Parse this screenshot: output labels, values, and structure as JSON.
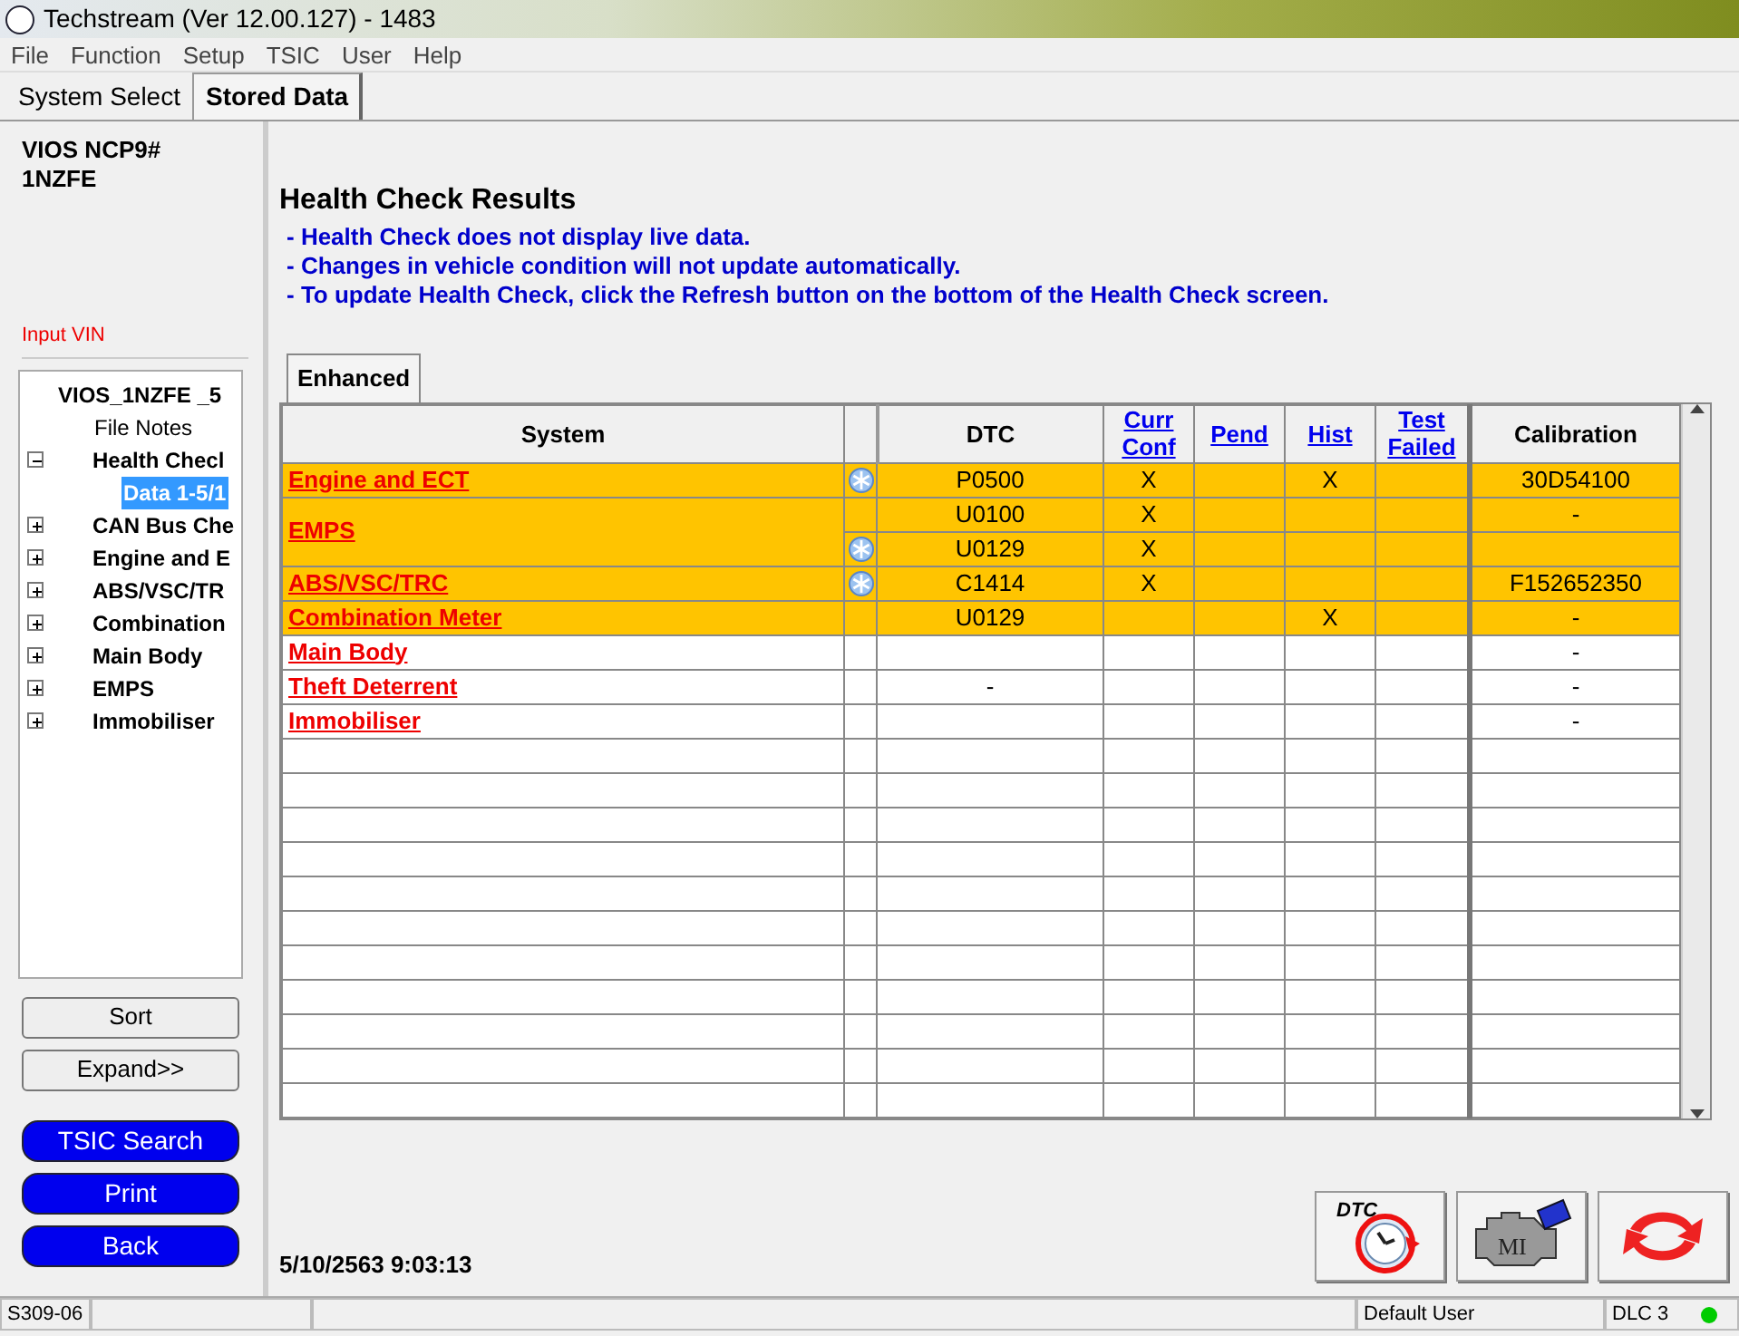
{
  "window": {
    "title": "Techstream (Ver 12.00.127) - 1483"
  },
  "menu": [
    "File",
    "Function",
    "Setup",
    "TSIC",
    "User",
    "Help"
  ],
  "tabs": [
    {
      "label": "System Select",
      "selected": false
    },
    {
      "label": "Stored Data",
      "selected": true
    }
  ],
  "vehicle": {
    "model": "VIOS NCP9#",
    "engine": "1NZFE",
    "vin_label": "Input VIN"
  },
  "tree": [
    {
      "label": "VIOS_1NZFE _5",
      "selected": false,
      "children": [
        {
          "label": "File Notes",
          "selected": false
        },
        {
          "label": "Health Checl",
          "expanded": true,
          "selected": false,
          "children": [
            {
              "label": "Data 1-5/1",
              "selected": true
            }
          ]
        },
        {
          "label": "CAN Bus Che",
          "expanded": false,
          "selected": false
        },
        {
          "label": "Engine and E",
          "expanded": false,
          "selected": false
        },
        {
          "label": "ABS/VSC/TR",
          "expanded": false,
          "selected": false
        },
        {
          "label": "Combination",
          "expanded": false,
          "selected": false
        },
        {
          "label": "Main Body",
          "expanded": false,
          "selected": false
        },
        {
          "label": "EMPS",
          "expanded": false,
          "selected": false
        },
        {
          "label": "Immobiliser",
          "expanded": false,
          "selected": false
        }
      ]
    }
  ],
  "side_buttons": [
    {
      "label": "Sort",
      "kind": "plain"
    },
    {
      "label": "Expand>>",
      "kind": "plain"
    },
    {
      "label": "TSIC Search",
      "kind": "blue"
    },
    {
      "label": "Print",
      "kind": "blue"
    },
    {
      "label": "Back",
      "kind": "blue"
    }
  ],
  "heading": "Health Check Results",
  "notes": [
    "- Health Check does not display live data.",
    "- Changes in vehicle condition will not update automatically.",
    "- To update Health Check, click the Refresh button on the bottom of the Health Check screen."
  ],
  "result_tabs": [
    {
      "label": "Enhanced",
      "selected": true
    }
  ],
  "table": {
    "columns": [
      {
        "label": "System",
        "link": false
      },
      {},
      {
        "label": "DTC",
        "link": false
      },
      {
        "label": "Curr Conf",
        "link": true
      },
      {
        "label": "Pend",
        "link": true
      },
      {
        "label": "Hist",
        "link": true
      },
      {
        "label": "Test Failed",
        "link": true
      },
      {
        "label": "Calibration",
        "link": false
      }
    ],
    "systems": [
      {
        "name": "Engine and ECT",
        "highlighted": true,
        "entries": [
          {
            "freeze_frame": true,
            "dtc": "P0500",
            "curr_conf": "X",
            "hist": "X",
            "calibration": "30D54100"
          }
        ]
      },
      {
        "name": "EMPS",
        "highlighted": true,
        "entries": [
          {
            "freeze_frame": false,
            "dtc": "U0100",
            "curr_conf": "X",
            "calibration": "-"
          },
          {
            "freeze_frame": true,
            "dtc": "U0129",
            "curr_conf": "X"
          }
        ]
      },
      {
        "name": "ABS/VSC/TRC",
        "highlighted": true,
        "entries": [
          {
            "freeze_frame": true,
            "dtc": "C1414",
            "curr_conf": "X",
            "calibration": "F152652350"
          }
        ]
      },
      {
        "name": "Combination Meter",
        "highlighted": true,
        "entries": [
          {
            "freeze_frame": false,
            "dtc": "U0129",
            "hist": "X",
            "calibration": "-"
          }
        ]
      },
      {
        "name": "Main Body",
        "highlighted": false,
        "entries": [
          {
            "freeze_frame": false,
            "calibration": "-"
          }
        ]
      },
      {
        "name": "Theft Deterrent",
        "highlighted": false,
        "entries": [
          {
            "freeze_frame": false,
            "dtc": "-",
            "calibration": "-"
          }
        ]
      },
      {
        "name": "Immobiliser",
        "highlighted": false,
        "entries": [
          {
            "freeze_frame": false,
            "calibration": "-"
          }
        ]
      }
    ]
  },
  "timestamp": "5/10/2563 9:03:13",
  "tool_buttons": [
    {
      "kind": "dtc-clock",
      "label": "DTC"
    },
    {
      "kind": "engine",
      "label": "MI"
    },
    {
      "kind": "refresh"
    }
  ],
  "status_bar": {
    "code": "S309-06",
    "user": "Default User",
    "port": "DLC 3"
  }
}
